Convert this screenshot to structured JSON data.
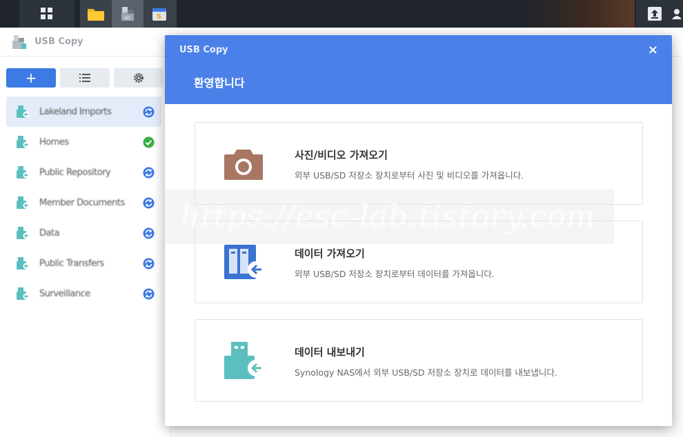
{
  "taskbar": {
    "apps": [
      {
        "name": "file-station",
        "icon": "folder-icon",
        "color": "#f5b62b"
      },
      {
        "name": "usb-copy",
        "icon": "usb-sd-icon",
        "active": true
      },
      {
        "name": "synology-app",
        "icon": "package-icon"
      }
    ]
  },
  "app": {
    "title": "USB Copy"
  },
  "toolbar": {
    "add_label": "+"
  },
  "tasks": [
    {
      "name": "Lakeland Imports",
      "status": "sync",
      "selected": true
    },
    {
      "name": "Homes",
      "status": "done"
    },
    {
      "name": "Public Repository",
      "status": "sync"
    },
    {
      "name": "Member Documents",
      "status": "sync"
    },
    {
      "name": "Data",
      "status": "sync"
    },
    {
      "name": "Public Transfers",
      "status": "sync"
    },
    {
      "name": "Surveillance",
      "status": "sync"
    }
  ],
  "modal": {
    "title": "USB Copy",
    "close_label": "×",
    "welcome": "환영합니다",
    "options": [
      {
        "title": "사진/비디오 가져오기",
        "description": "외부 USB/SD 저장소 장치로부터 사진 및 비디오를 가져옵니다.",
        "icon": "camera-icon",
        "color": "#a87763"
      },
      {
        "title": "데이터 가져오기",
        "description": "외부 USB/SD 저장소 장치로부터 데이터를 가져옵니다.",
        "icon": "import-data-icon",
        "color": "#3b73d1"
      },
      {
        "title": "데이터 내보내기",
        "description": "Synology NAS에서 외부 USB/SD 저장소 장치로 데이터를 내보냅니다.",
        "icon": "export-data-icon",
        "color": "#5cbfbf"
      }
    ]
  },
  "watermark": "https://esc-lab.tistory.com",
  "colors": {
    "accent": "#4a80e8",
    "primary_button": "#3c7ae4",
    "sync_status": "#3c7ae4",
    "done_status": "#3bae43"
  }
}
